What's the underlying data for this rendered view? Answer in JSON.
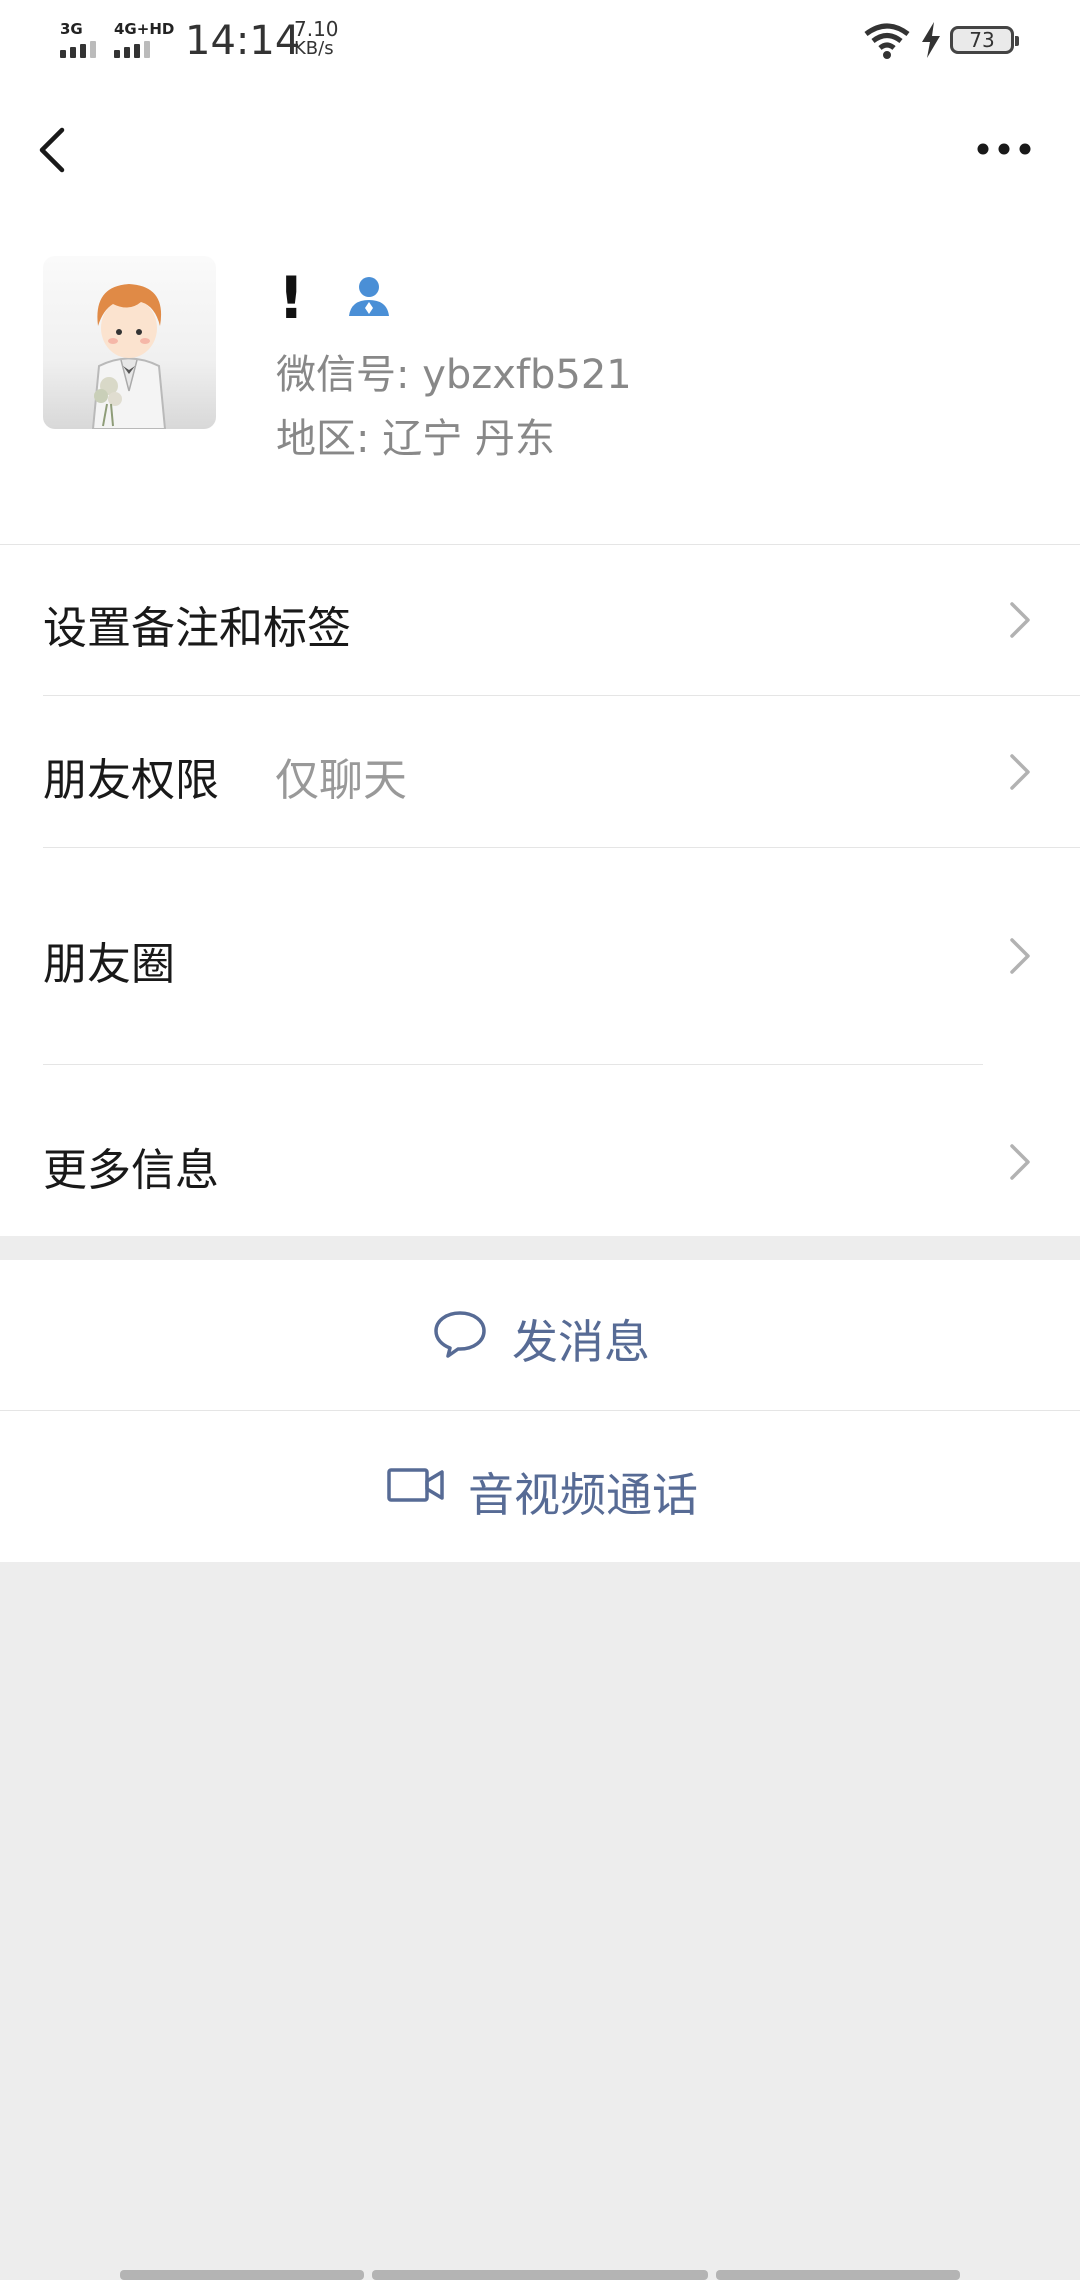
{
  "status_bar": {
    "net1": "3G",
    "net2": "4G+HD",
    "time": "14:14",
    "speed_value": "7.10",
    "speed_unit": "KB/s",
    "battery": "73"
  },
  "profile": {
    "nickname": "!",
    "wechat_id": "微信号: ybzxfb521",
    "region": "地区: 辽宁  丹东"
  },
  "rows": {
    "remark_tags": "设置备注和标签",
    "permissions_label": "朋友权限",
    "permissions_value": "仅聊天",
    "moments": "朋友圈",
    "more_info": "更多信息"
  },
  "actions": {
    "send_message": "发消息",
    "av_call": "音视频通话"
  },
  "colors": {
    "link_blue": "#576b95",
    "icon_blue": "#4a8fd6",
    "background": "#ededed"
  }
}
